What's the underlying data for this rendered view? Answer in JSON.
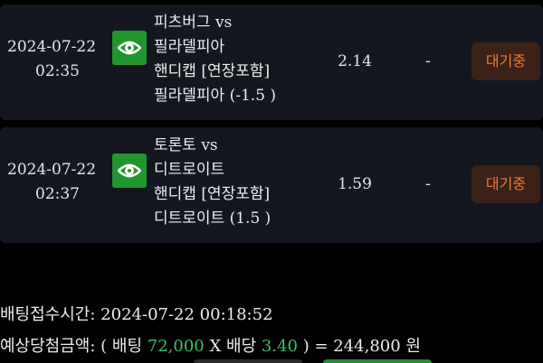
{
  "bets": [
    {
      "date": "2024-07-22",
      "time": "02:35",
      "match_line": "피츠버그 vs",
      "team_line": "필라델피아",
      "market": "핸디캡 [연장포함]",
      "pick": "필라델피아 (-1.5 )",
      "odds": "2.14",
      "result": "-",
      "status": "대기중"
    },
    {
      "date": "2024-07-22",
      "time": "02:37",
      "match_line": "토론토 vs",
      "team_line": "디트로이트",
      "market": "핸디캡 [연장포함]",
      "pick": "디트로이트 (1.5 )",
      "odds": "1.59",
      "result": "-",
      "status": "대기중"
    }
  ],
  "summary": {
    "time_label": "배팅접수시간:",
    "time_value": "2024-07-22 00:18:52",
    "win_label": "예상당첨금액:",
    "open_paren": "( 배팅",
    "bet_amount": "72,000",
    "x_sep": "X 배당",
    "total_odds": "3.40",
    "equals_part": ") = 244,800 원"
  },
  "colors": {
    "card_bg": "#14171f",
    "eye_button": "#22962e",
    "status_text": "#f07a33",
    "highlight": "#3bbf6a"
  },
  "icons": {
    "view": "eye-icon"
  }
}
